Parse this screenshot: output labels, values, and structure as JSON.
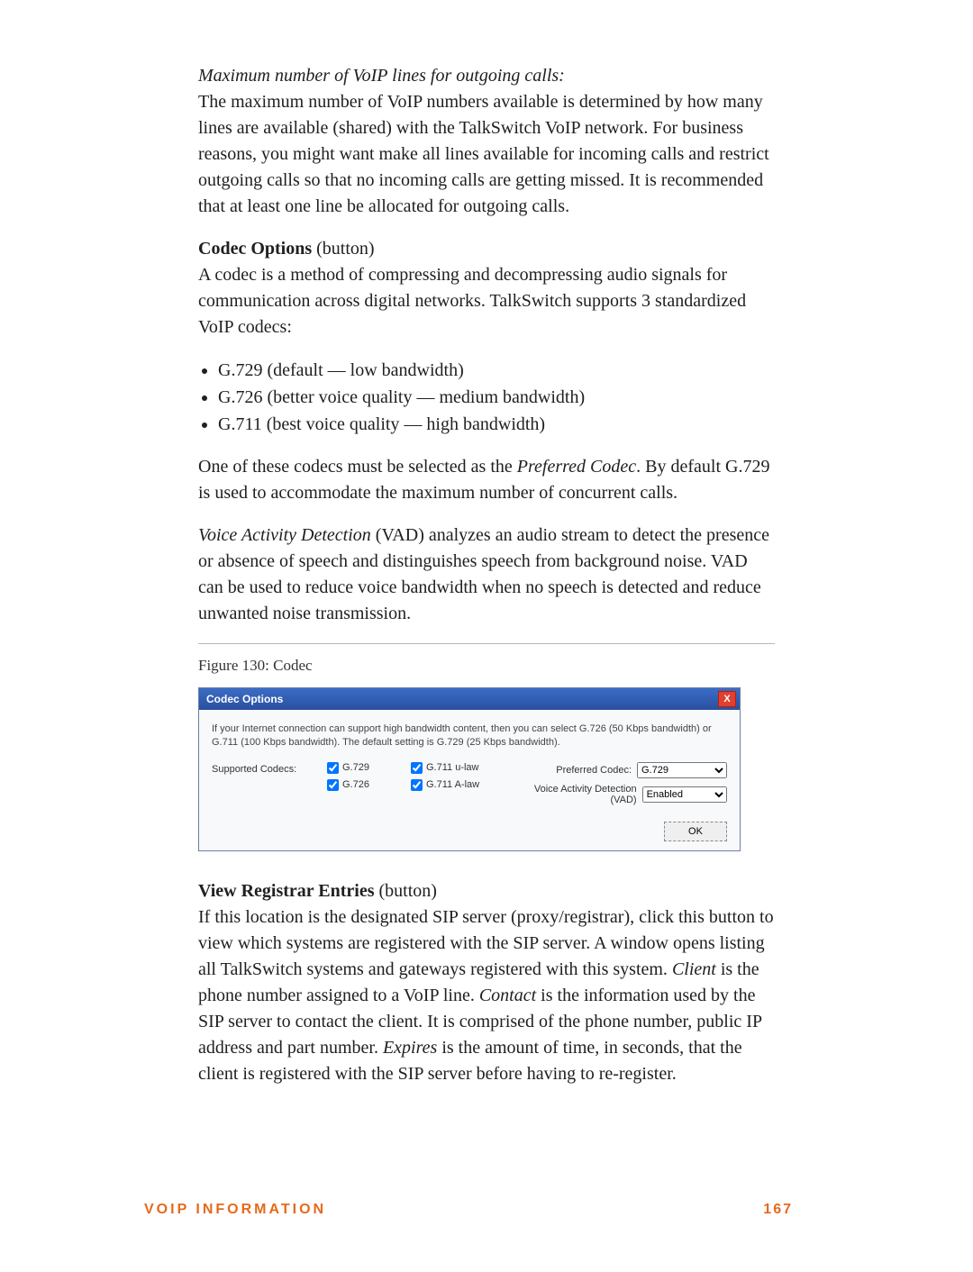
{
  "body": {
    "p1_heading": "Maximum number of VoIP lines for outgoing calls:",
    "p1": "The maximum number of VoIP numbers available is determined by how many lines are available (shared) with the TalkSwitch VoIP network. For business reasons, you might want make all lines available for incoming calls and restrict outgoing calls so that no incoming calls are getting missed. It is recommended that at least one line be allocated for outgoing calls.",
    "p2_strong": "Codec Options",
    "p2_tail": " (button)",
    "p3": "A codec is a method of compressing and decompressing audio signals for communication across digital networks. TalkSwitch supports 3 standardized VoIP codecs:",
    "bullets": [
      "G.729 (default — low bandwidth)",
      "G.726 (better voice quality — medium bandwidth)",
      "G.711 (best voice quality — high bandwidth)"
    ],
    "p4a": "One of these codecs must be selected as the ",
    "p4b_italic": "Preferred Codec",
    "p4c": ". By default G.729 is used to accommodate the maximum number of concurrent calls.",
    "p5a_italic": "Voice Activity Detection",
    "p5b": " (VAD) analyzes an audio stream to detect the presence or absence of speech and distinguishes speech from background noise. VAD can be used to reduce voice bandwidth when no speech is detected and reduce unwanted noise transmission.",
    "figcap": "Figure 130:  Codec",
    "p6_strong": "View Registrar Entries",
    "p6_tail": " (button)",
    "p7a": "If this location is the designated SIP server (proxy/registrar), click this button to view which systems are registered with the SIP server. A window opens listing all TalkSwitch systems and gateways registered with this system. ",
    "p7b_italic": "Client",
    "p7c": " is the phone number assigned to a VoIP line. ",
    "p7d_italic": "Contact",
    "p7e": " is the information used by the SIP server to contact the client. It is comprised of the phone number, public IP address and part number. ",
    "p7f_italic": "Expires",
    "p7g": " is the amount of time, in seconds, that the client is registered with the SIP server before having to re-register."
  },
  "dialog": {
    "title": "Codec Options",
    "explain": "If your Internet connection can support high bandwidth content, then you can select G.726 (50 Kbps bandwidth) or G.711 (100 Kbps bandwidth).  The default setting is G.729 (25 Kbps bandwidth).",
    "supported_label": "Supported Codecs:",
    "cb1": "G.729",
    "cb2": "G.726",
    "cb3": "G.711 u-law",
    "cb4": "G.711 A-law",
    "preferred_label": "Preferred Codec:",
    "preferred_value": "G.729",
    "vad_label": "Voice Activity Detection (VAD)",
    "vad_value": "Enabled",
    "ok": "OK",
    "close": "X"
  },
  "footer": {
    "left": "VOIP INFORMATION",
    "right": "167"
  }
}
